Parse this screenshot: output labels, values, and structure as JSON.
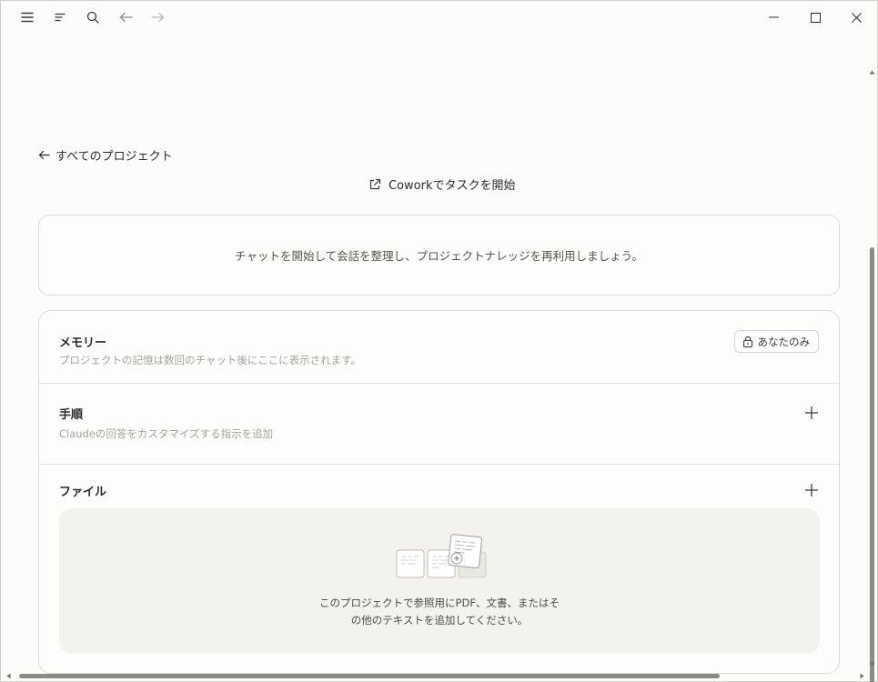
{
  "titlebar": {
    "icons": [
      "menu-icon",
      "sidebar-toggle-icon",
      "search-icon",
      "back-arrow-icon",
      "forward-arrow-icon"
    ],
    "window_controls": [
      "minimize-icon",
      "maximize-icon",
      "close-icon"
    ]
  },
  "nav": {
    "back_label": "すべてのプロジェクト",
    "cowork_label": "Coworkでタスクを開始"
  },
  "chat": {
    "prompt": "チャットを開始して会話を整理し、プロジェクトナレッジを再利用しましょう。"
  },
  "memory": {
    "title": "メモリー",
    "subtitle": "プロジェクトの記憶は数回のチャット後にここに表示されます。",
    "visibility_label": "あなたのみ"
  },
  "instructions": {
    "title": "手順",
    "subtitle": "Claudeの回答をカスタマイズする指示を追加"
  },
  "files": {
    "title": "ファイル",
    "empty_line1": "このプロジェクトで参照用にPDF、文書、またはそ",
    "empty_line2": "の他のテキストを追加してください。"
  },
  "colors": {
    "background": "#fcfcfb",
    "drop_zone": "#f3f2ef",
    "border": "#dcdcd8",
    "muted_text": "#a3a39e"
  }
}
